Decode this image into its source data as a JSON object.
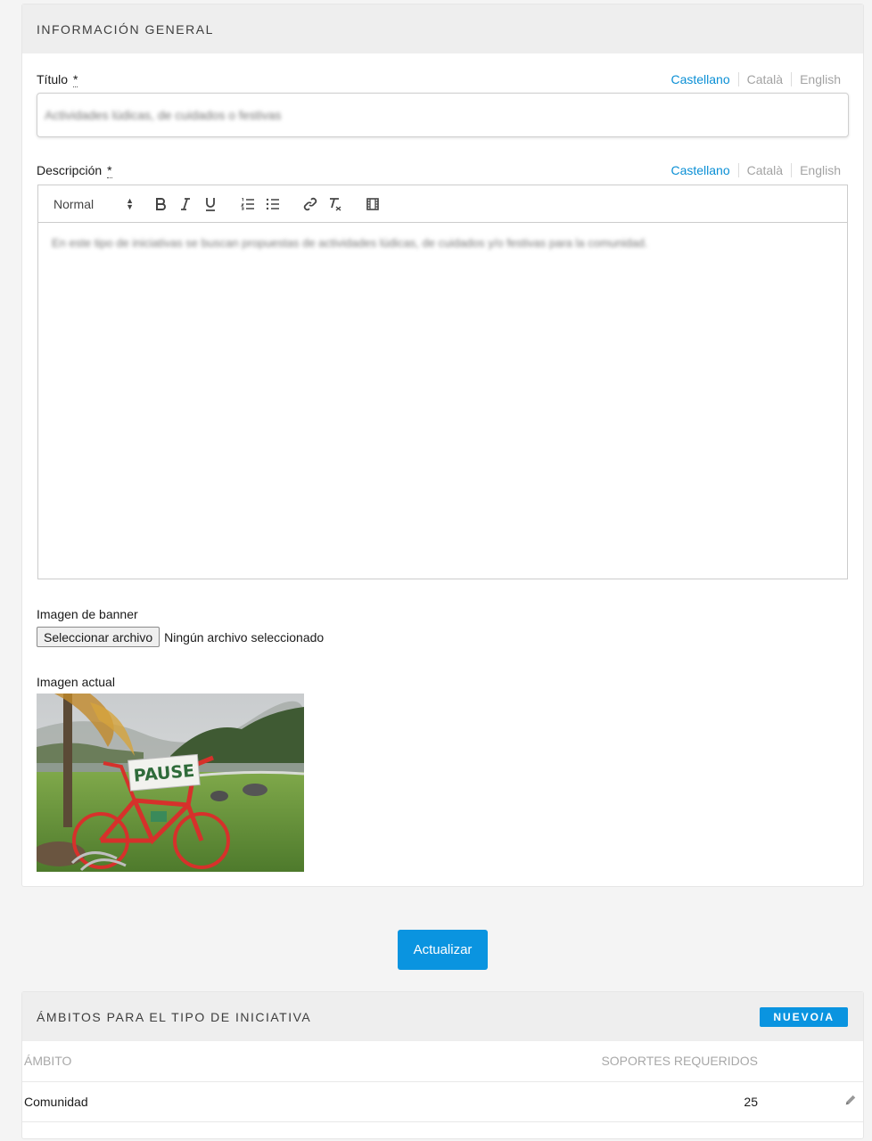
{
  "info": {
    "title": "INFORMACIÓN GENERAL",
    "titulo": {
      "label": "Título",
      "required_mark": "*",
      "languages": [
        "Castellano",
        "Català",
        "English"
      ],
      "value": "Actividades lúdicas, de cuidados o festivas"
    },
    "descripcion": {
      "label": "Descripción",
      "required_mark": "*",
      "languages": [
        "Castellano",
        "Català",
        "English"
      ],
      "toolbar_format": "Normal",
      "value": "En este tipo de iniciativas se buscan propuestas de actividades lúdicas, de cuidados y/o festivas para la comunidad."
    },
    "banner": {
      "label": "Imagen de banner",
      "button_label": "Seleccionar archivo",
      "status": "Ningún archivo seleccionado"
    },
    "current_image": {
      "label": "Imagen actual",
      "sign_text": "PAUSE"
    }
  },
  "actions": {
    "update_label": "Actualizar"
  },
  "ambitos": {
    "title": "ÁMBITOS PARA EL TIPO DE INICIATIVA",
    "new_label": "NUEVO/A",
    "columns": [
      "ÁMBITO",
      "SOPORTES REQUERIDOS"
    ],
    "rows": [
      {
        "ambito": "Comunidad",
        "soportes": "25"
      }
    ]
  },
  "colors": {
    "accent": "#0a94e0",
    "lang_active": "#0a8fd5",
    "lang_inactive": "#a3a3a3"
  }
}
